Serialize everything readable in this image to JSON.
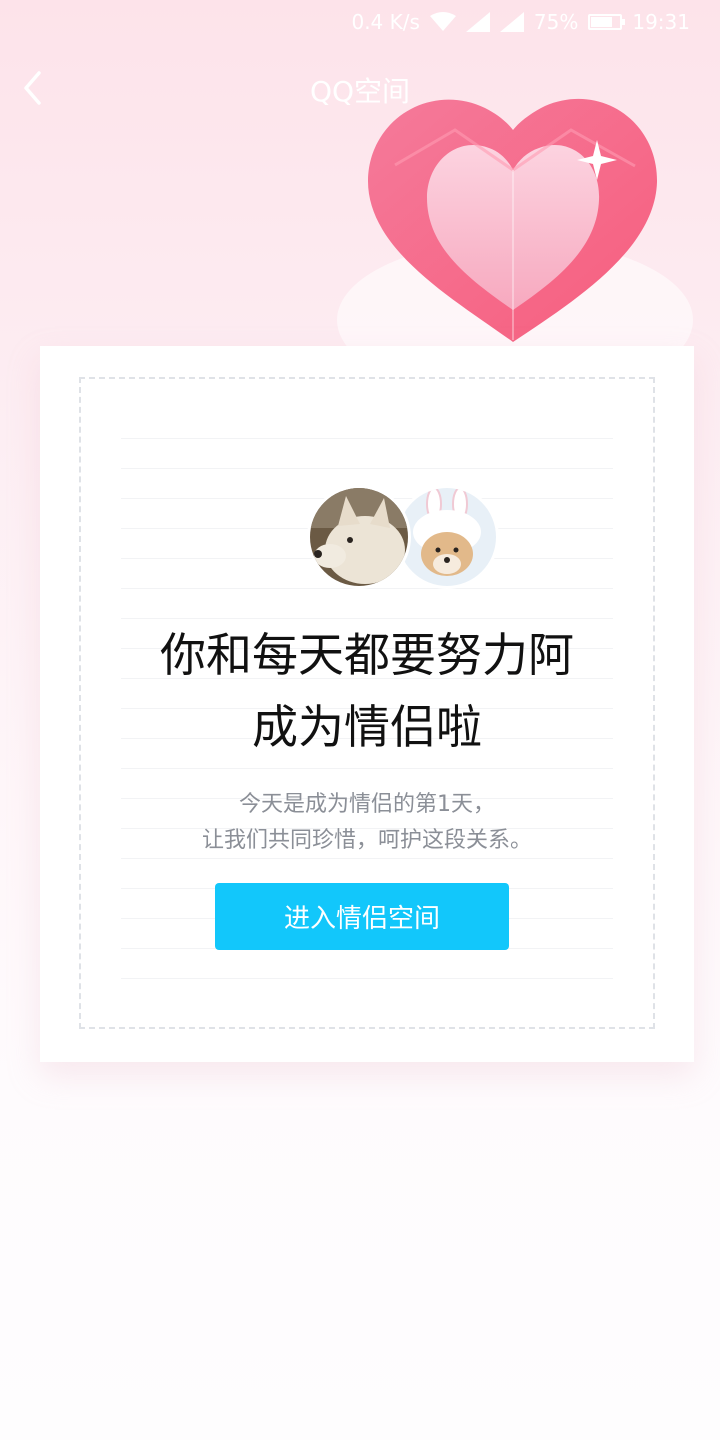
{
  "status_bar": {
    "network_speed": "0.4 K/s",
    "battery_percent": "75%",
    "battery_level": 0.75,
    "time": "19:31"
  },
  "title_bar": {
    "title": "QQ空间",
    "back_icon": "chevron-left-icon"
  },
  "card": {
    "avatars": [
      "dog-avatar",
      "dog-bunny-hat-avatar"
    ],
    "headline_line1": "你和每天都要努力阿",
    "headline_line2": "成为情侣啦",
    "sub_line1": "今天是成为情侣的第1天，",
    "sub_line2": "让我们共同珍惜，呵护这段关系。",
    "button_label": "进入情侣空间"
  },
  "colors": {
    "accent": "#12c7fb",
    "heart": "#f56d8e"
  }
}
